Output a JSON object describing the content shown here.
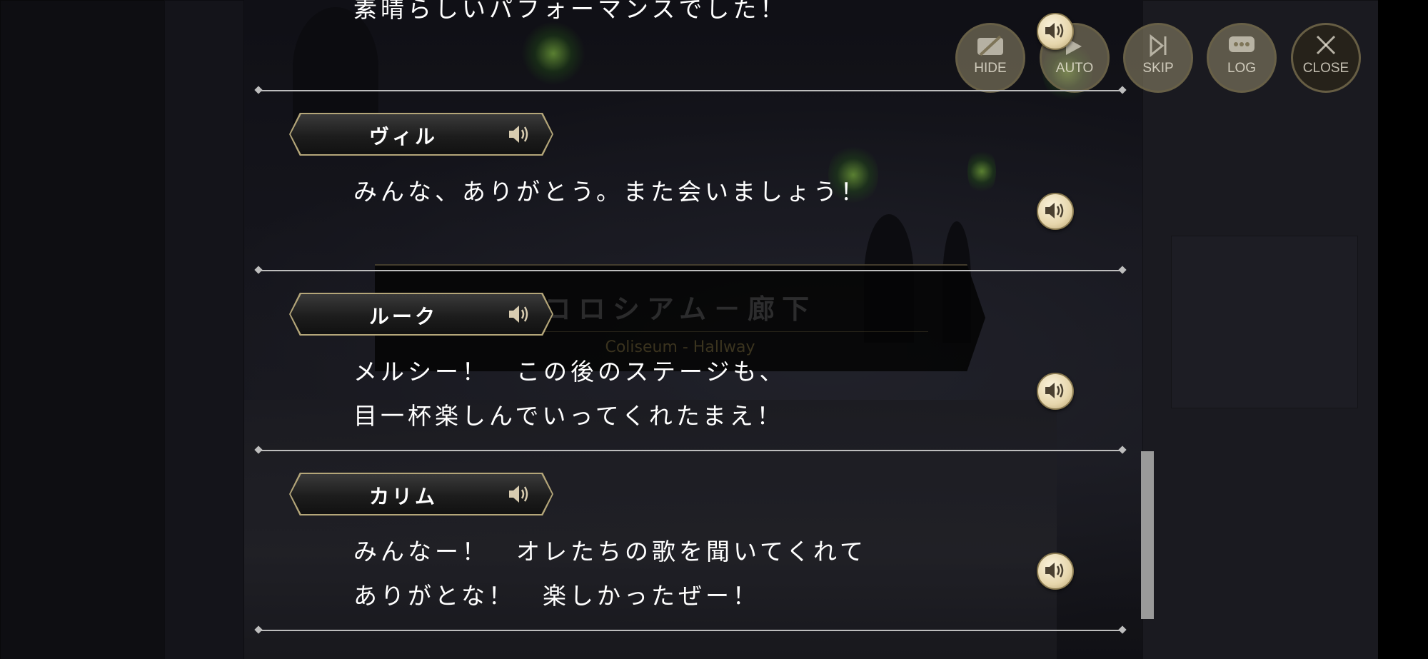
{
  "location": {
    "title_jp": "コロシアム－廊下",
    "title_en": "Coliseum - Hallway"
  },
  "top_buttons": {
    "hide": "HIDE",
    "auto": "AUTO",
    "skip": "SKIP",
    "log": "LOG",
    "close": "CLOSE"
  },
  "log": {
    "partial_line": "素晴らしいパフォーマンスでした！",
    "entries": [
      {
        "speaker": "ヴィル",
        "lines": [
          "みんな、ありがとう。また会いましょう！"
        ]
      },
      {
        "speaker": "ルーク",
        "lines": [
          "メルシー！　この後のステージも、",
          "目一杯楽しんでいってくれたまえ！"
        ]
      },
      {
        "speaker": "カリム",
        "lines": [
          "みんなー！　オレたちの歌を聞いてくれて",
          "ありがとな！　楽しかったぜー！"
        ]
      }
    ]
  },
  "colors": {
    "gold": "#b4a679",
    "voice_button": "#e6d6ac",
    "text": "#ffffff"
  }
}
